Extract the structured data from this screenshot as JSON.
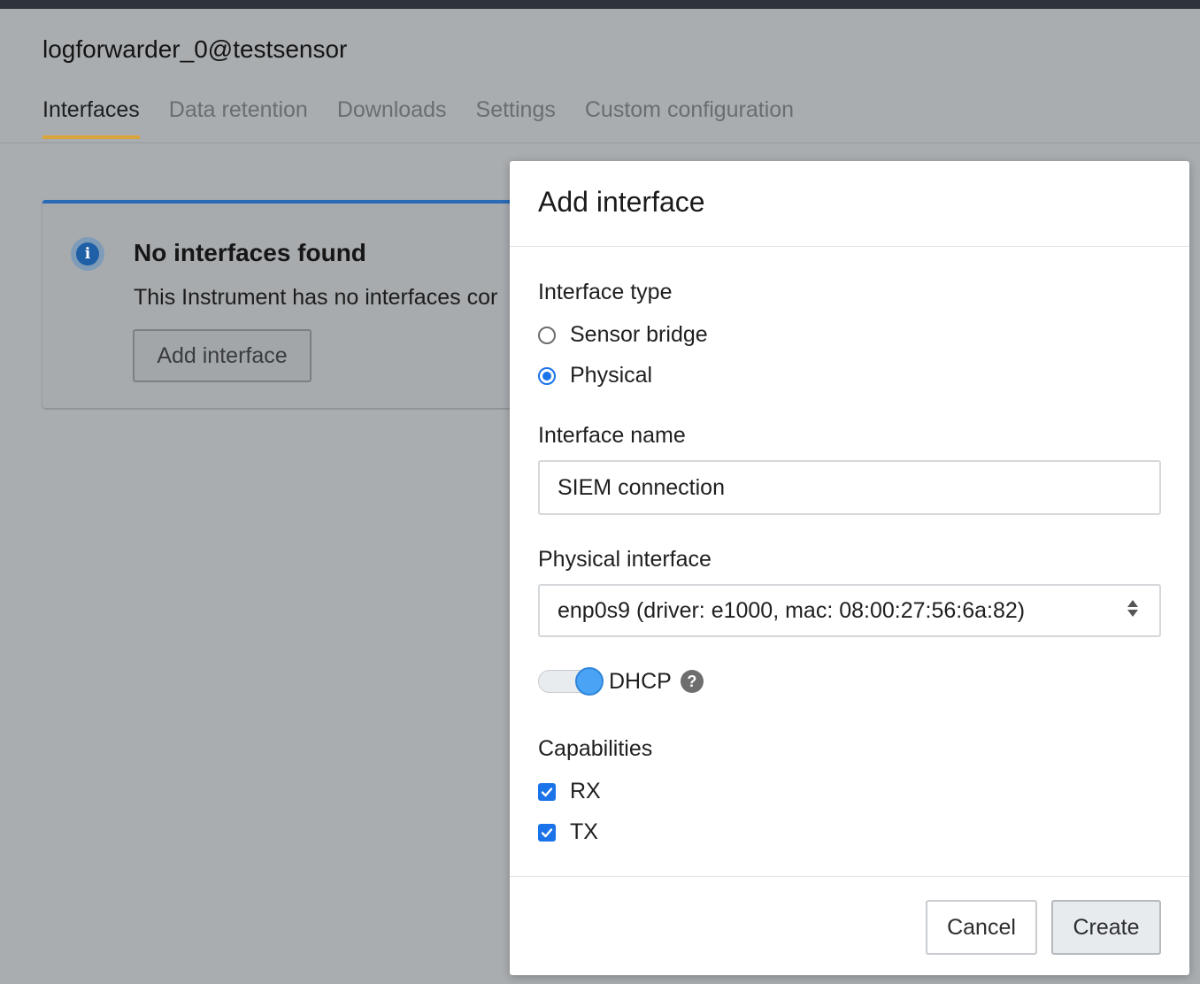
{
  "header": {
    "title": "logforwarder_0@testsensor",
    "tabs": [
      {
        "label": "Interfaces",
        "active": true
      },
      {
        "label": "Data retention",
        "active": false
      },
      {
        "label": "Downloads",
        "active": false
      },
      {
        "label": "Settings",
        "active": false
      },
      {
        "label": "Custom configuration",
        "active": false
      }
    ]
  },
  "card": {
    "icon": "info-icon",
    "title": "No interfaces found",
    "text": "This Instrument has no interfaces cor",
    "button_label": "Add interface"
  },
  "modal": {
    "title": "Add interface",
    "interface_type": {
      "label": "Interface type",
      "options": [
        {
          "label": "Sensor bridge",
          "selected": false
        },
        {
          "label": "Physical",
          "selected": true
        }
      ]
    },
    "interface_name": {
      "label": "Interface name",
      "value": "SIEM connection"
    },
    "physical_interface": {
      "label": "Physical interface",
      "selected": "enp0s9 (driver: e1000, mac: 08:00:27:56:6a:82)"
    },
    "dhcp": {
      "label": "DHCP",
      "enabled": true,
      "help_icon": "question-mark-icon"
    },
    "capabilities": {
      "label": "Capabilities",
      "items": [
        {
          "label": "RX",
          "checked": true
        },
        {
          "label": "TX",
          "checked": true
        }
      ]
    },
    "cancel_label": "Cancel",
    "create_label": "Create"
  },
  "colors": {
    "accent": "#1a73e8",
    "tab_underline": "#d9a53a",
    "info_border": "#2a6bb7",
    "overlay_bg": "#a9adb0"
  }
}
